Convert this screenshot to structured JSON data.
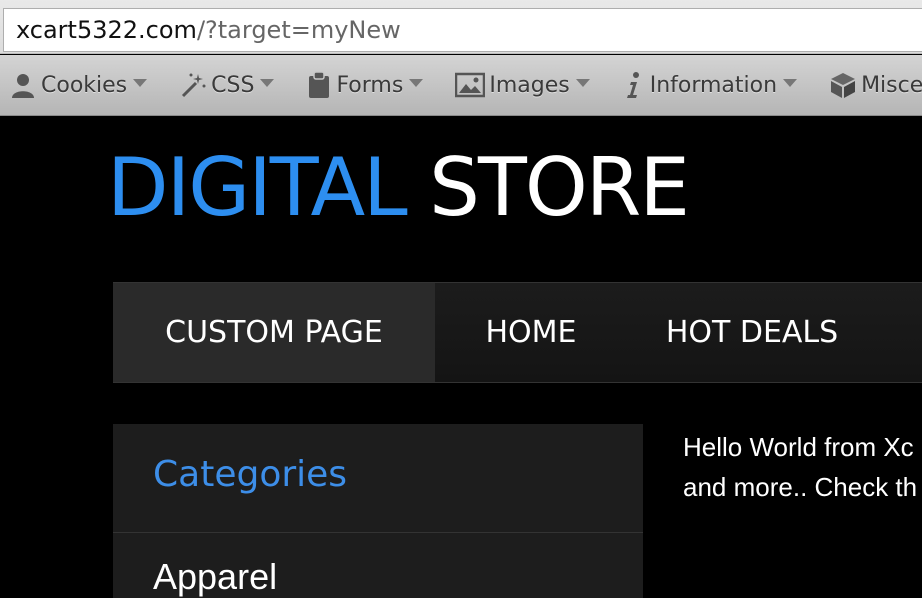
{
  "browser": {
    "url_host": "xcart5322.com",
    "url_path": "/?target=myNew"
  },
  "toolbar": {
    "items": [
      {
        "label": "Cookies",
        "icon": "user-icon"
      },
      {
        "label": "CSS",
        "icon": "magic-wand-icon"
      },
      {
        "label": "Forms",
        "icon": "clipboard-icon"
      },
      {
        "label": "Images",
        "icon": "image-icon"
      },
      {
        "label": "Information",
        "icon": "info-icon"
      },
      {
        "label": "Miscell",
        "icon": "package-icon"
      }
    ]
  },
  "store": {
    "logo_accent": "DIGITAL",
    "logo_rest": " STORE",
    "accent_color": "#2d8ef0"
  },
  "nav": {
    "items": [
      {
        "label": "CUSTOM PAGE",
        "active": true
      },
      {
        "label": "HOME",
        "active": false
      },
      {
        "label": "HOT DEALS",
        "active": false
      }
    ]
  },
  "sidebar": {
    "title": "Categories",
    "items": [
      "Apparel"
    ]
  },
  "content": {
    "line1": "Hello World from Xc",
    "line2": "and more.. Check th"
  }
}
